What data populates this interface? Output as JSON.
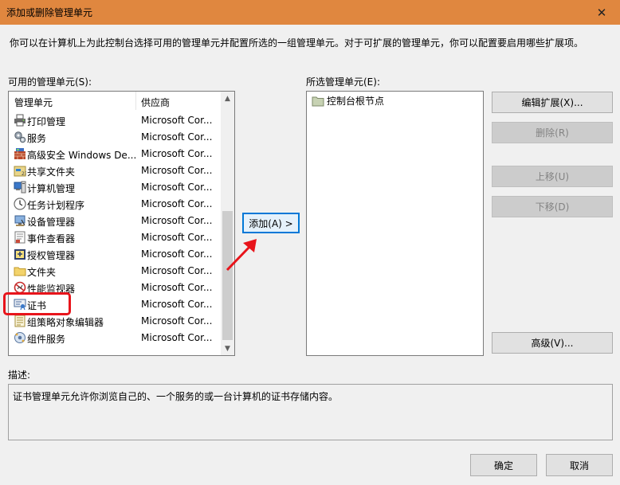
{
  "window": {
    "title": "添加或删除管理单元",
    "close_glyph": "✕"
  },
  "description": "你可以在计算机上为此控制台选择可用的管理单元并配置所选的一组管理单元。对于可扩展的管理单元，你可以配置要启用哪些扩展项。",
  "available": {
    "label": "可用的管理单元(S):",
    "columns": {
      "name": "管理单元",
      "vendor": "供应商"
    },
    "items": [
      {
        "name": "打印管理",
        "vendor": "Microsoft Cor...",
        "icon": "printer-icon"
      },
      {
        "name": "服务",
        "vendor": "Microsoft Cor...",
        "icon": "gears-icon"
      },
      {
        "name": "高级安全 Windows De...",
        "vendor": "Microsoft Cor...",
        "icon": "firewall-icon"
      },
      {
        "name": "共享文件夹",
        "vendor": "Microsoft Cor...",
        "icon": "shared-folder-icon"
      },
      {
        "name": "计算机管理",
        "vendor": "Microsoft Cor...",
        "icon": "computer-management-icon"
      },
      {
        "name": "任务计划程序",
        "vendor": "Microsoft Cor...",
        "icon": "clock-icon"
      },
      {
        "name": "设备管理器",
        "vendor": "Microsoft Cor...",
        "icon": "device-manager-icon"
      },
      {
        "name": "事件查看器",
        "vendor": "Microsoft Cor...",
        "icon": "event-viewer-icon"
      },
      {
        "name": "授权管理器",
        "vendor": "Microsoft Cor...",
        "icon": "authorization-icon"
      },
      {
        "name": "文件夹",
        "vendor": "Microsoft Cor...",
        "icon": "folder-icon"
      },
      {
        "name": "性能监视器",
        "vendor": "Microsoft Cor...",
        "icon": "performance-icon"
      },
      {
        "name": "证书",
        "vendor": "Microsoft Cor...",
        "icon": "certificate-icon"
      },
      {
        "name": "组策略对象编辑器",
        "vendor": "Microsoft Cor...",
        "icon": "group-policy-icon"
      },
      {
        "name": "组件服务",
        "vendor": "Microsoft Cor...",
        "icon": "component-services-icon"
      }
    ]
  },
  "add_button": "添加(A) >",
  "selected": {
    "label": "所选管理单元(E):",
    "items": [
      {
        "name": "控制台根节点",
        "icon": "console-root-folder-icon"
      }
    ]
  },
  "buttons": {
    "edit_extensions": "编辑扩展(X)...",
    "remove": "删除(R)",
    "move_up": "上移(U)",
    "move_down": "下移(D)",
    "advanced": "高级(V)...",
    "ok": "确定",
    "cancel": "取消"
  },
  "desc_label": "描述:",
  "desc_text": "证书管理单元允许你浏览自己的、一个服务的或一台计算机的证书存储内容。",
  "colors": {
    "titlebar": "#e0873f",
    "highlight": "#e8141b",
    "focus": "#0078d7"
  }
}
